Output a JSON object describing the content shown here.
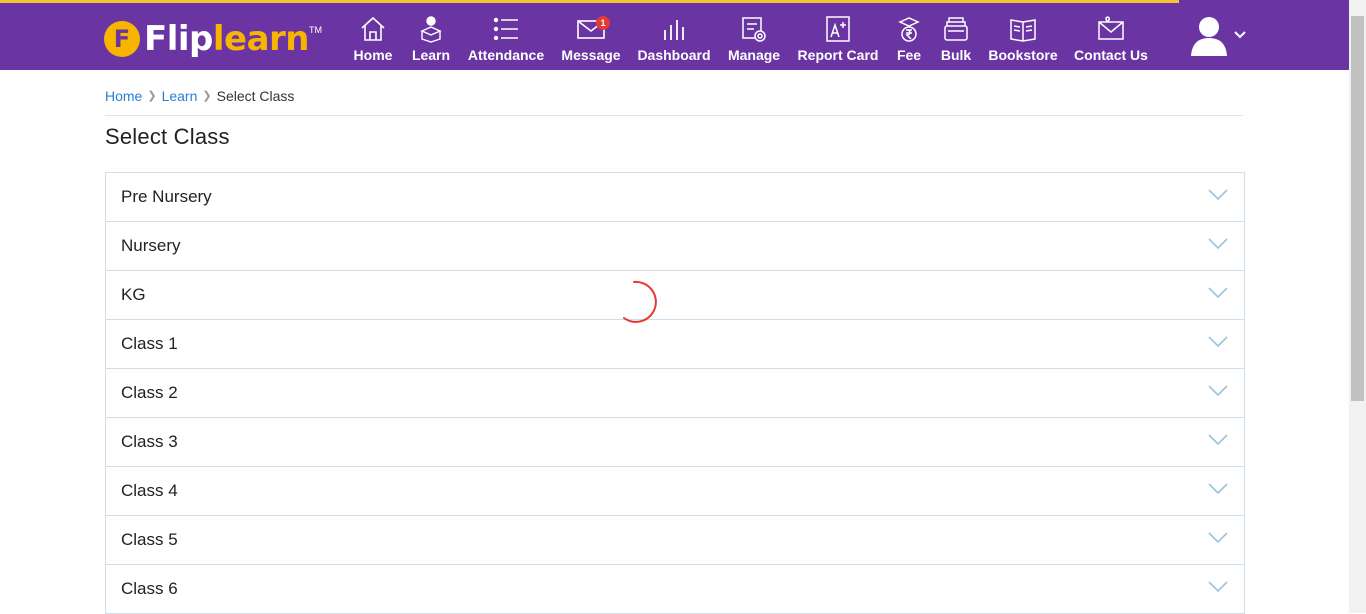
{
  "app": {
    "logo_mark": "F",
    "logo_text_1": "Flip",
    "logo_text_2": "learn",
    "logo_tm": "TM"
  },
  "nav": {
    "items": [
      {
        "label": "Home",
        "icon": "home-icon"
      },
      {
        "label": "Learn",
        "icon": "learn-icon"
      },
      {
        "label": "Attendance",
        "icon": "attendance-icon"
      },
      {
        "label": "Message",
        "icon": "message-icon",
        "badge": "1"
      },
      {
        "label": "Dashboard",
        "icon": "dashboard-icon"
      },
      {
        "label": "Manage",
        "icon": "manage-icon"
      },
      {
        "label": "Report Card",
        "icon": "report-card-icon"
      },
      {
        "label": "Fee",
        "icon": "fee-icon"
      },
      {
        "label": "Bulk",
        "icon": "bulk-icon"
      },
      {
        "label": "Bookstore",
        "icon": "bookstore-icon"
      },
      {
        "label": "Contact Us",
        "icon": "contact-icon"
      }
    ]
  },
  "breadcrumb": {
    "home": "Home",
    "learn": "Learn",
    "current": "Select Class"
  },
  "page": {
    "title": "Select Class"
  },
  "classes": [
    "Pre Nursery",
    "Nursery",
    "KG",
    "Class 1",
    "Class 2",
    "Class 3",
    "Class 4",
    "Class 5",
    "Class 6"
  ],
  "colors": {
    "header_bg": "#6a35a3",
    "accent_yellow": "#f7b500",
    "link_blue": "#2a7fd4",
    "spinner_red": "#e53935",
    "border": "#cfe0ea"
  }
}
